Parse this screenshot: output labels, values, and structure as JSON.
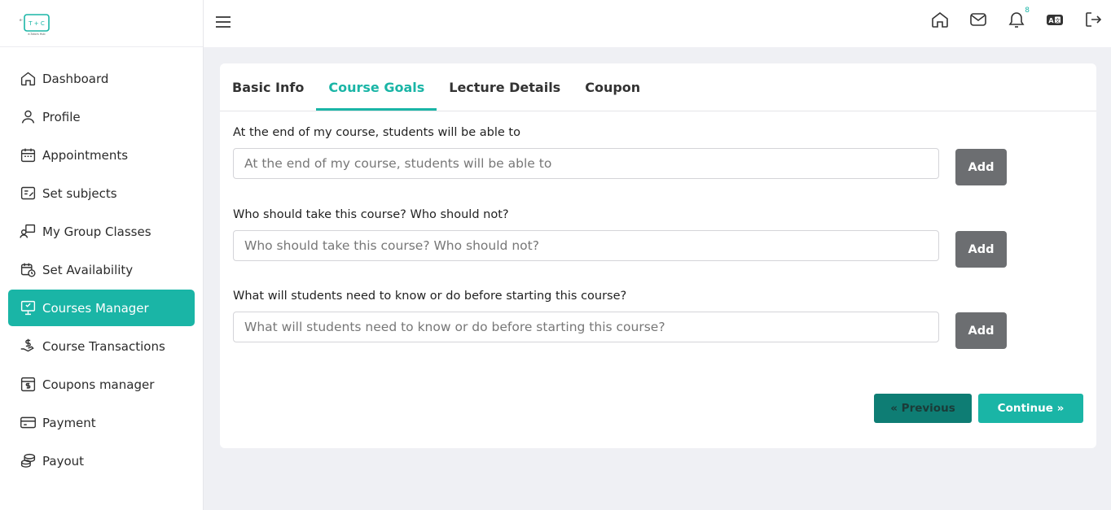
{
  "logo": {
    "text": "T + C",
    "tagline": "e-Tutors Hub"
  },
  "sidebar": {
    "items": [
      {
        "label": "Dashboard",
        "icon": "home-icon"
      },
      {
        "label": "Profile",
        "icon": "user-icon"
      },
      {
        "label": "Appointments",
        "icon": "calendar-icon"
      },
      {
        "label": "Set subjects",
        "icon": "subjects-icon"
      },
      {
        "label": "My Group Classes",
        "icon": "group-classes-icon"
      },
      {
        "label": "Set Availability",
        "icon": "availability-icon"
      },
      {
        "label": "Courses Manager",
        "icon": "monitor-icon",
        "active": true
      },
      {
        "label": "Course Transactions",
        "icon": "transactions-icon"
      },
      {
        "label": "Coupons manager",
        "icon": "coupon-icon"
      },
      {
        "label": "Payment",
        "icon": "card-icon"
      },
      {
        "label": "Payout",
        "icon": "coins-icon"
      }
    ]
  },
  "header": {
    "notification_count": "8",
    "icons": [
      "home-icon",
      "mail-icon",
      "bell-icon",
      "language-icon",
      "logout-icon"
    ]
  },
  "tabs": [
    {
      "label": "Basic Info",
      "active": false
    },
    {
      "label": "Course Goals",
      "active": true
    },
    {
      "label": "Lecture Details",
      "active": false
    },
    {
      "label": "Coupon",
      "active": false
    }
  ],
  "goals": [
    {
      "label": "At the end of my course, students will be able to",
      "placeholder": "At the end of my course, students will be able to",
      "value": "",
      "button": "Add"
    },
    {
      "label": "Who should take this course? Who should not?",
      "placeholder": "Who should take this course? Who should not?",
      "value": "",
      "button": "Add"
    },
    {
      "label": "What will students need to know or do before starting this course?",
      "placeholder": "What will students need to know or do before starting this course?",
      "value": "",
      "button": "Add"
    }
  ],
  "actions": {
    "previous": "« Previous",
    "continue": "Continue »"
  },
  "colors": {
    "accent": "#1ab5a6",
    "previous_bg": "#0e7d74",
    "add_bg": "#6c6e71"
  }
}
